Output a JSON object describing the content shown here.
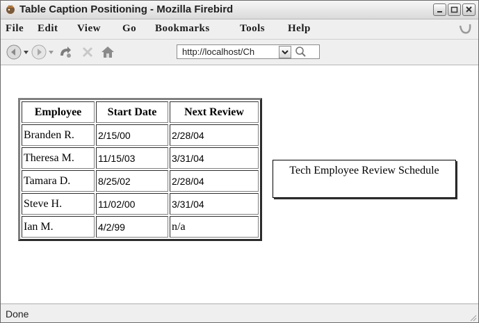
{
  "window": {
    "title": "Table Caption Positioning - Mozilla Firebird"
  },
  "menu": [
    {
      "label": "File"
    },
    {
      "label": "Edit"
    },
    {
      "label": "View"
    },
    {
      "label": "Go"
    },
    {
      "label": "Bookmarks"
    },
    {
      "label": "Tools"
    },
    {
      "label": "Help"
    }
  ],
  "navbar": {
    "url": "http://localhost/Ch"
  },
  "table": {
    "headers": [
      "Employee",
      "Start Date",
      "Next Review"
    ],
    "rows": [
      [
        "Branden R.",
        "2/15/00",
        "2/28/04"
      ],
      [
        "Theresa M.",
        "11/15/03",
        "3/31/04"
      ],
      [
        "Tamara D.",
        "8/25/02",
        "2/28/04"
      ],
      [
        "Steve H.",
        "11/02/00",
        "3/31/04"
      ],
      [
        "Ian M.",
        "4/2/99",
        "n/a"
      ]
    ],
    "caption": "Tech Employee Review Schedule"
  },
  "status": {
    "text": "Done"
  }
}
